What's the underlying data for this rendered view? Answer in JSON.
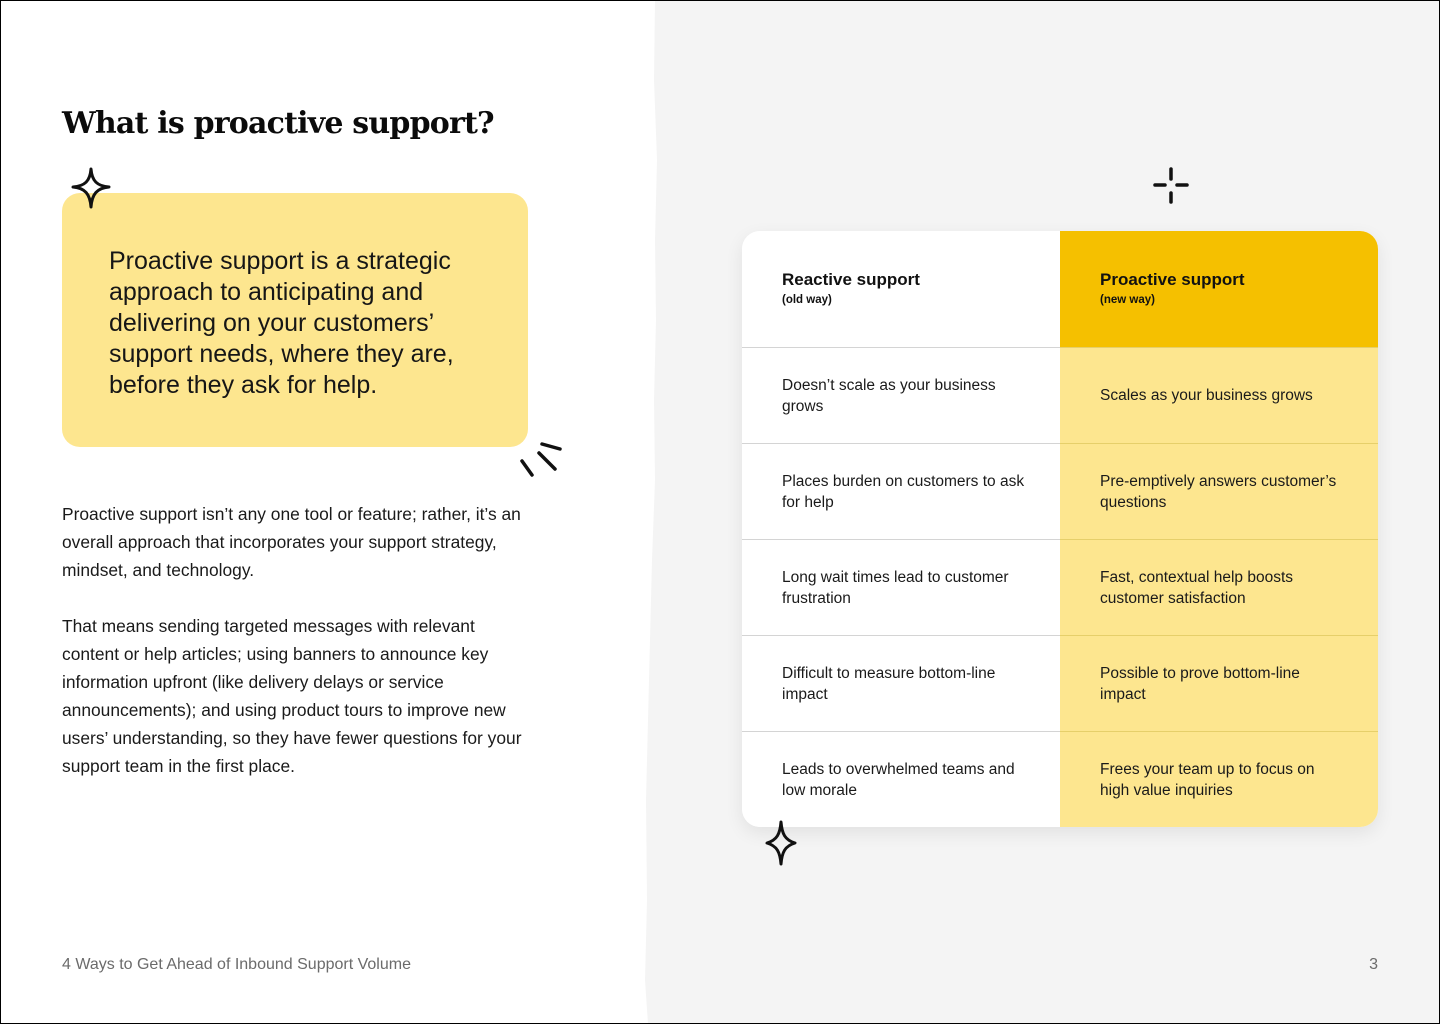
{
  "page": {
    "title": "What is proactive support?",
    "callout": "Proactive support is a strategic approach to anticipating and delivering on your customers’ support needs, where they are, before they ask for help.",
    "paragraphs": [
      "Proactive support isn’t any one tool or feature; rather, it’s an overall approach that incorporates your support strategy, mindset, and technology.",
      "That means sending targeted messages with relevant content or help articles; using banners to announce key information upfront (like delivery delays or service announcements); and using product tours to improve new users’ understanding, so they have fewer questions for your support team in the first place."
    ],
    "footer_title": "4 Ways to Get Ahead of Inbound Support Volume",
    "page_number": "3"
  },
  "comparison": {
    "reactive": {
      "title": "Reactive support",
      "subtitle": "(old way)"
    },
    "proactive": {
      "title": "Proactive support",
      "subtitle": "(new way)"
    },
    "rows": [
      {
        "reactive": "Doesn’t scale as your business grows",
        "proactive": "Scales as your business grows"
      },
      {
        "reactive": "Places burden on customers to ask for help",
        "proactive": "Pre-emptively answers customer’s questions"
      },
      {
        "reactive": "Long wait times lead to customer frustration",
        "proactive": "Fast, contextual help boosts customer satisfaction"
      },
      {
        "reactive": "Difficult to measure bottom-line impact",
        "proactive": "Possible to prove bottom-line impact"
      },
      {
        "reactive": "Leads to overwhelmed teams and low morale",
        "proactive": "Frees your team up to focus on high value inquiries"
      }
    ]
  },
  "colors": {
    "accent_yellow": "#f5c000",
    "light_yellow": "#fde68f",
    "right_panel_bg": "#f4f4f4"
  },
  "icons": [
    "sparkle-icon",
    "plus-sparkle-icon",
    "burst-lines-icon"
  ]
}
